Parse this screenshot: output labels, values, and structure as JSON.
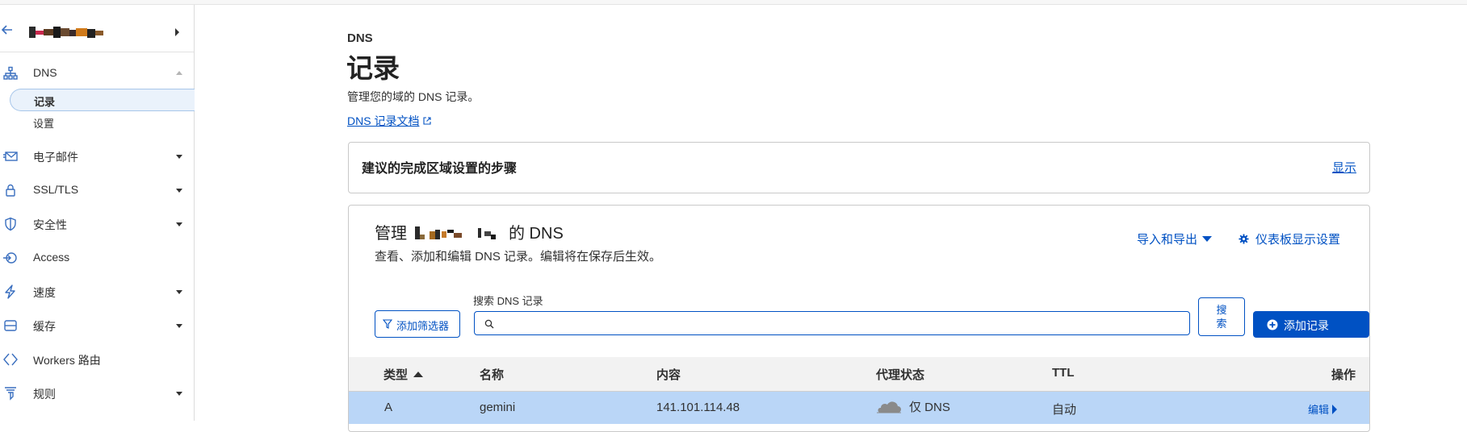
{
  "sidebar": {
    "items": [
      {
        "label": "DNS"
      },
      {
        "label": "电子邮件"
      },
      {
        "label": "SSL/TLS"
      },
      {
        "label": "安全性"
      },
      {
        "label": "Access"
      },
      {
        "label": "速度"
      },
      {
        "label": "缓存"
      },
      {
        "label": "Workers 路由"
      },
      {
        "label": "规则"
      }
    ],
    "dns_sub": [
      {
        "label": "记录"
      },
      {
        "label": "设置"
      }
    ]
  },
  "header": {
    "eyebrow": "DNS",
    "title": "记录",
    "description": "管理您的域的 DNS 记录。",
    "doc_link": "DNS 记录文档"
  },
  "setup_card": {
    "title": "建议的完成区域设置的步骤",
    "show_link": "显示"
  },
  "manage_card": {
    "title_prefix": "管理",
    "title_suffix": "的 DNS",
    "description": "查看、添加和编辑 DNS 记录。编辑将在保存后生效。",
    "import_export": "导入和导出",
    "dashboard_settings": "仪表板显示设置",
    "filter_button": "添加筛选器",
    "search_label": "搜索 DNS 记录",
    "search_value": "",
    "search_button_line1": "搜",
    "search_button_line2": "索",
    "add_record": "添加记录"
  },
  "table": {
    "headers": {
      "type": "类型",
      "name": "名称",
      "content": "内容",
      "proxy": "代理状态",
      "ttl": "TTL",
      "actions": "操作"
    },
    "rows": [
      {
        "type": "A",
        "name": "gemini",
        "content": "141.101.114.48",
        "proxy": "仅 DNS",
        "ttl": "自动",
        "action": "编辑"
      }
    ]
  },
  "colors": {
    "accent": "#0051c3",
    "row_highlight": "#bad6f7",
    "header_bg": "#f2f2f2"
  }
}
